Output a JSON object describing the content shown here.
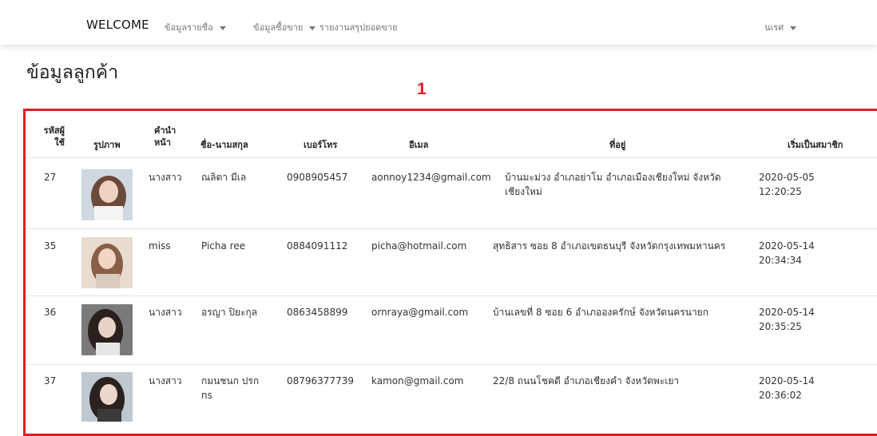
{
  "navbar": {
    "brand": "WELCOME",
    "menu": [
      {
        "label": "ข้อมูลรายชื่อ"
      },
      {
        "label": "ข้อมูลซื้อขาย"
      },
      {
        "label": "รายงานสรุปยอดขาย"
      }
    ],
    "user": "นเรศ"
  },
  "page": {
    "title": "ข้อมูลลูกค้า",
    "annotation_number": "1"
  },
  "table": {
    "headers": {
      "id_line1": "รหัสผู้",
      "id_line2": "ใช้",
      "image": "รูปภาพ",
      "prefix_line1": "คำนำ",
      "prefix_line2": "หน้า",
      "name": "ชื่อ-นามสกุล",
      "phone": "เบอร์โทร",
      "email": "อีเมล",
      "address": "ที่อยู่",
      "joined": "เริ่มเป็นสมาชิก"
    },
    "rows": [
      {
        "id": "27",
        "prefix": "นางสาว",
        "name_line1": "ณลิตา มีเล",
        "name_line2": "",
        "phone": "0908905457",
        "email": "aonnoy1234@gmail.com",
        "address_line1": "บ้านมะม่วง อำเภอย่าโม อำเภอเมืองเชียงใหม่ จังหวัด",
        "address_line2": "เชียงใหม่",
        "date": "2020-05-05",
        "time": "12:20:25",
        "thumb_colors": [
          "#cfd8e0",
          "#6b4a3a",
          "#f0d2c0"
        ]
      },
      {
        "id": "35",
        "prefix": "miss",
        "name_line1": "Picha ree",
        "name_line2": "",
        "phone": "0884091112",
        "email": "picha@hotmail.com",
        "address_line1": "สุทธิสาร ซอย 8 อำเภอเขตธนบุรี จังหวัดกรุงเทพมหานคร",
        "address_line2": "",
        "date": "2020-05-14",
        "time": "20:34:34",
        "thumb_colors": [
          "#e8dccf",
          "#8a5e46",
          "#f2d5c5"
        ]
      },
      {
        "id": "36",
        "prefix": "นางสาว",
        "name_line1": "อรญา ปิยะกุล",
        "name_line2": "",
        "phone": "0863458899",
        "email": "ornraya@gmail.com",
        "address_line1": "บ้านเลขที่ 8 ซอย 6 อำเภอองครักษ์ จังหวัดนครนายก",
        "address_line2": "",
        "date": "2020-05-14",
        "time": "20:35:25",
        "thumb_colors": [
          "#7a7a7a",
          "#2a211d",
          "#e9d3c8"
        ]
      },
      {
        "id": "37",
        "prefix": "นางสาว",
        "name_line1": "กมนชนก ปรก",
        "name_line2": "ns",
        "phone": "08796377739",
        "email": "kamon@gmail.com",
        "address_line1": "22/8 ถนนโชคดี อำเภอเชียงคำ จังหวัดพะเยา",
        "address_line2": "",
        "date": "2020-05-14",
        "time": "20:36:02",
        "thumb_colors": [
          "#bfc7cf",
          "#2b2220",
          "#edd6cb"
        ]
      }
    ]
  }
}
